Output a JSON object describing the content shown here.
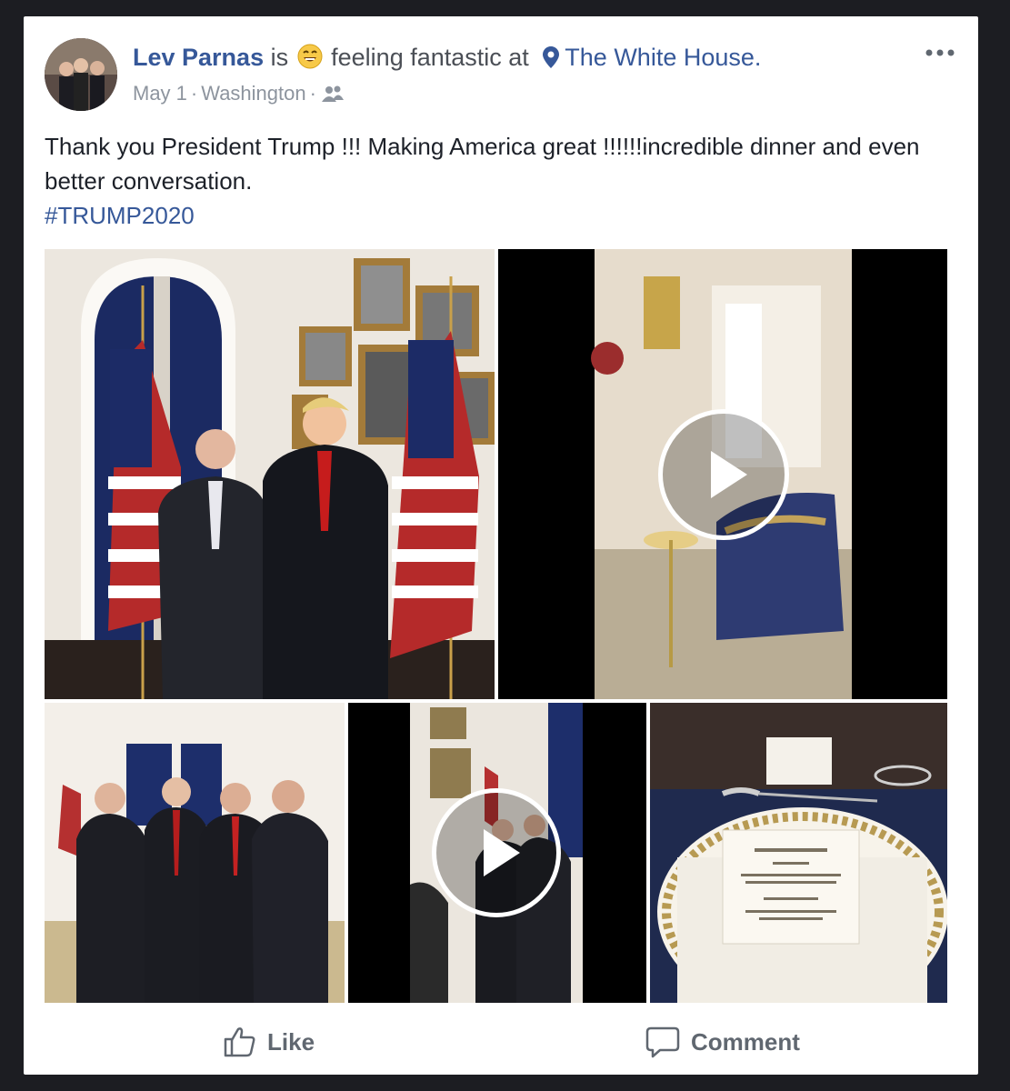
{
  "post": {
    "author": "Lev Parnas",
    "verb": "is",
    "feeling": "feeling fantastic at",
    "feeling_emoji": "grinning-face-icon",
    "location": "The White House.",
    "date": "May 1",
    "city": "Washington",
    "audience_icon": "friends-icon",
    "text": "Thank you President Trump !!! Making America great !!!!!!incredible dinner and even better conversation.",
    "hashtag": "#TRUMP2020"
  },
  "media": [
    {
      "kind": "photo",
      "description_icon": "photo-icon"
    },
    {
      "kind": "video",
      "description_icon": "video-play-icon"
    },
    {
      "kind": "photo",
      "description_icon": "photo-icon"
    },
    {
      "kind": "video",
      "description_icon": "video-play-icon"
    },
    {
      "kind": "photo",
      "description_icon": "photo-icon"
    }
  ],
  "actions": {
    "like_label": "Like",
    "comment_label": "Comment"
  },
  "colors": {
    "link": "#365899",
    "text": "#1d2129",
    "meta": "#8d949e",
    "background": "#1c1d22"
  }
}
